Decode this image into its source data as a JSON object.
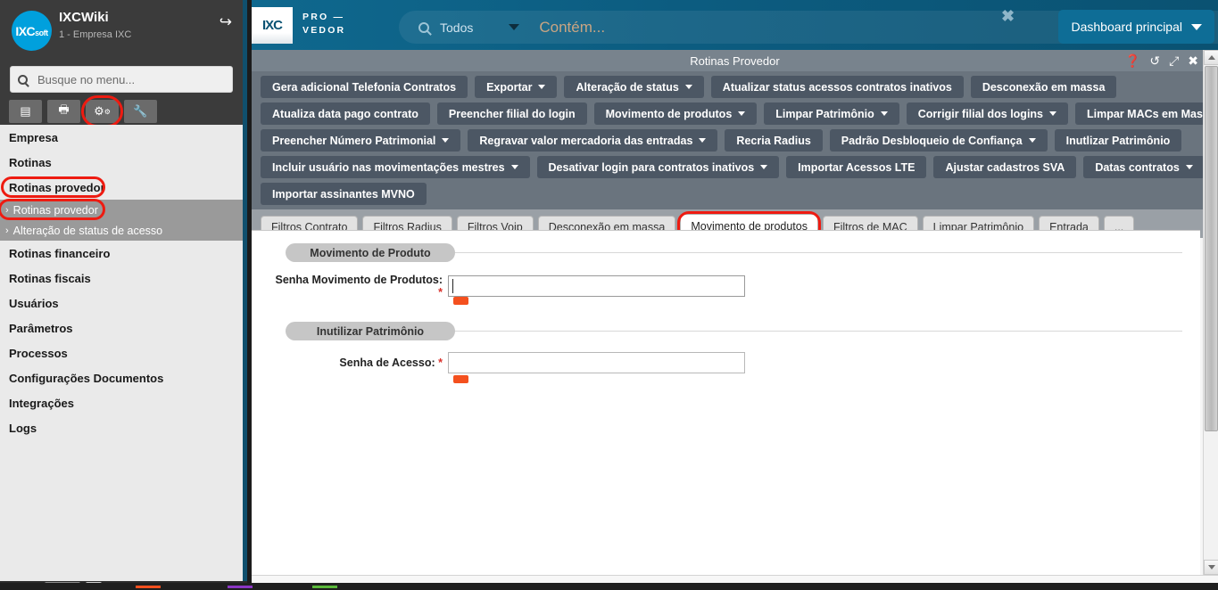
{
  "sidebar": {
    "brand_title": "IXCWiki",
    "brand_subtitle": "1 - Empresa IXC",
    "logo_text": "IXC",
    "logo_suffix": "soft",
    "logout_icon": "logout-icon",
    "search_placeholder": "Busque no menu...",
    "search_value": "",
    "tool_buttons": [
      {
        "name": "list-view-icon",
        "glyph": "▤"
      },
      {
        "name": "print-icon",
        "glyph": "⎙"
      },
      {
        "name": "gears-icon",
        "glyph": "⚙"
      },
      {
        "name": "wrench-icon",
        "glyph": "🔧"
      }
    ],
    "highlighted_tool_index": 2,
    "items": [
      {
        "label": "Empresa"
      },
      {
        "label": "Rotinas"
      },
      {
        "label": "Rotinas provedor",
        "highlighted": true
      },
      {
        "label": "Rotinas financeiro"
      },
      {
        "label": "Rotinas fiscais"
      },
      {
        "label": "Usuários"
      },
      {
        "label": "Parâmetros"
      },
      {
        "label": "Processos"
      },
      {
        "label": "Configurações Documentos"
      },
      {
        "label": "Integrações"
      },
      {
        "label": "Logs"
      }
    ],
    "submenu": {
      "parent_index": 2,
      "items": [
        {
          "label": "Rotinas provedor",
          "highlighted": true
        },
        {
          "label": "Alteração de status de acesso",
          "highlighted": false
        }
      ]
    }
  },
  "topbar": {
    "logo_text": "IXC",
    "product_line1": "PRO —",
    "product_line2": "VEDOR",
    "search_scope": "Todos",
    "search_placeholder": "Contém...",
    "search_value": "",
    "clear_icon": "✖",
    "dashboard_label": "Dashboard principal"
  },
  "window": {
    "title": "Rotinas Provedor",
    "icons": [
      {
        "name": "help-icon",
        "glyph": "❓"
      },
      {
        "name": "history-icon",
        "glyph": "↺"
      },
      {
        "name": "expand-icon",
        "glyph": "⤡"
      },
      {
        "name": "close-icon",
        "glyph": "✖"
      }
    ]
  },
  "action_buttons": [
    [
      {
        "label": "Gera adicional Telefonia Contratos",
        "dropdown": false
      },
      {
        "label": "Exportar",
        "dropdown": true
      },
      {
        "label": "Alteração de status",
        "dropdown": true
      },
      {
        "label": "Atualizar status acessos contratos inativos",
        "dropdown": false
      },
      {
        "label": "Desconexão em massa",
        "dropdown": false
      }
    ],
    [
      {
        "label": "Atualiza data pago contrato",
        "dropdown": false
      },
      {
        "label": "Preencher filial do login",
        "dropdown": false
      },
      {
        "label": "Movimento de produtos",
        "dropdown": true
      },
      {
        "label": "Limpar Patrimônio",
        "dropdown": true
      },
      {
        "label": "Corrigir filial dos logins",
        "dropdown": true
      },
      {
        "label": "Limpar MACs em Massa",
        "dropdown": false
      }
    ],
    [
      {
        "label": "Preencher Número Patrimonial",
        "dropdown": true
      },
      {
        "label": "Regravar valor mercadoria das entradas",
        "dropdown": true
      },
      {
        "label": "Recria Radius",
        "dropdown": false
      },
      {
        "label": "Padrão Desbloqueio de Confiança",
        "dropdown": true
      },
      {
        "label": "Inutlizar Patrimônio",
        "dropdown": false
      }
    ],
    [
      {
        "label": "Incluir usuário nas movimentações mestres",
        "dropdown": true
      },
      {
        "label": "Desativar login para contratos inativos",
        "dropdown": true
      },
      {
        "label": "Importar Acessos LTE",
        "dropdown": false
      },
      {
        "label": "Ajustar cadastros SVA",
        "dropdown": false
      },
      {
        "label": "Datas contratos",
        "dropdown": true
      }
    ],
    [
      {
        "label": "Importar assinantes MVNO",
        "dropdown": false
      }
    ]
  ],
  "tabs": [
    {
      "label": "Filtros Contrato",
      "active": false
    },
    {
      "label": "Filtros Radius",
      "active": false
    },
    {
      "label": "Filtros Voip",
      "active": false
    },
    {
      "label": "Desconexão em massa",
      "active": false
    },
    {
      "label": "Movimento de produtos",
      "active": true,
      "highlighted": true
    },
    {
      "label": "Filtros de MAC",
      "active": false
    },
    {
      "label": "Limpar Patrimônio",
      "active": false
    },
    {
      "label": "Entrada",
      "active": false
    },
    {
      "label": "...",
      "active": false
    }
  ],
  "form": {
    "sections": [
      {
        "legend": "Movimento de Produto",
        "field_label": "Senha Movimento de Produtos:",
        "required_marker": "*",
        "field_value": "",
        "focused": true
      },
      {
        "legend": "Inutilizar Patrimônio",
        "field_label": "Senha de Acesso:",
        "required_marker": "*",
        "field_value": "",
        "focused": false
      }
    ]
  },
  "colors": {
    "accent_blue": "#0a5272",
    "highlight_red": "#ee1b11",
    "button_dark": "#4c5764",
    "panel_gray": "#6a747e",
    "tagstrip_orange": "#f4501e",
    "sidebar_bg": "#eaeaea"
  }
}
